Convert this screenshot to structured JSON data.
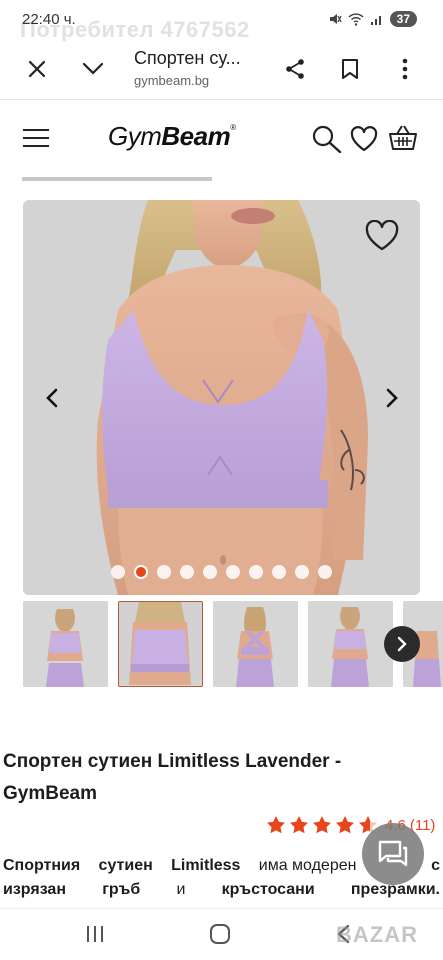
{
  "status_bar": {
    "time": "22:40 ч.",
    "watermark": "Потребител 4767562",
    "battery": "37"
  },
  "browser": {
    "page_title": "Спортен су...",
    "url": "gymbeam.bg"
  },
  "site_header": {
    "logo_light": "Gym",
    "logo_bold": "Beam",
    "logo_mark": "®"
  },
  "gallery": {
    "dot_count": 10,
    "active_dot_index": 1
  },
  "thumbnails": {
    "selected_index": 1
  },
  "product": {
    "title": "Спортен сутиен Limitless Lavender - GymBeam",
    "rating_value": "4.6",
    "rating_count": "(11)",
    "stars_full": 4,
    "stars_partial": 0.6,
    "description_words": [
      "Спортния",
      "сутиен",
      "Limitless"
    ],
    "description_rest_1": "има модерен",
    "description_c": "с",
    "description_line2": [
      "изрязан",
      "гръб",
      "и",
      "кръстосани",
      "презрамки."
    ]
  },
  "footer": {
    "watermark": "BAZAR"
  },
  "colors": {
    "accent": "#e9451c",
    "lavender": "#c9b2e2",
    "dark": "#1d1d1d"
  },
  "icons": [
    "close-icon",
    "chevron-down-icon",
    "share-icon",
    "bookmark-icon",
    "more-vert-icon",
    "hamburger-menu-icon",
    "search-icon",
    "heart-icon",
    "basket-icon",
    "chevron-left-icon",
    "chevron-right-icon",
    "star-icon",
    "chat-icon"
  ]
}
